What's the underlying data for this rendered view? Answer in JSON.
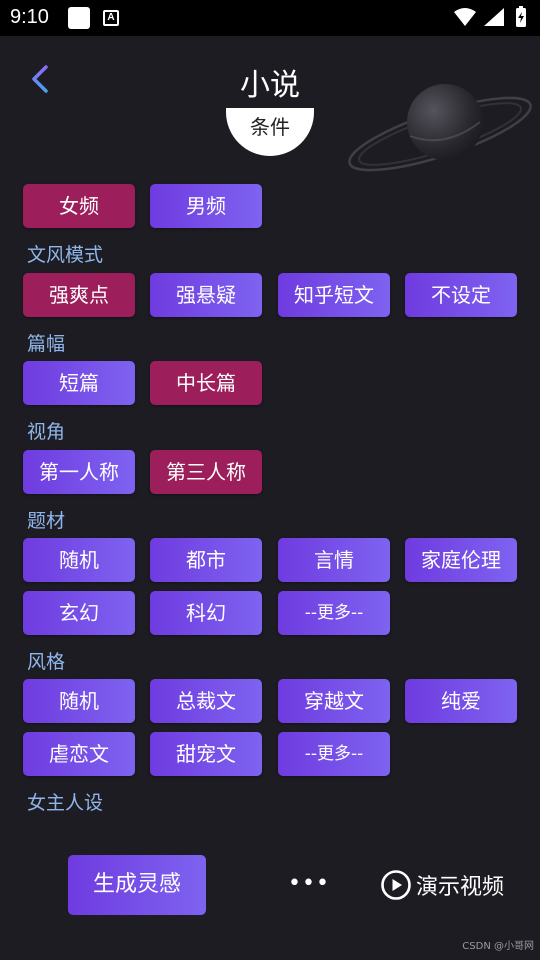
{
  "status": {
    "time": "9:10",
    "a_icon": "A"
  },
  "header": {
    "title": "小说",
    "badge": "条件"
  },
  "gender": {
    "options": [
      "女频",
      "男频"
    ]
  },
  "sections": [
    {
      "label": "文风模式",
      "options": [
        "强爽点",
        "强悬疑",
        "知乎短文",
        "不设定"
      ]
    },
    {
      "label": "篇幅",
      "options": [
        "短篇",
        "中长篇"
      ]
    },
    {
      "label": "视角",
      "options": [
        "第一人称",
        "第三人称"
      ]
    },
    {
      "label": "题材",
      "options": [
        "随机",
        "都市",
        "言情",
        "家庭伦理",
        "玄幻",
        "科幻",
        "--更多--"
      ]
    },
    {
      "label": "风格",
      "options": [
        "随机",
        "总裁文",
        "穿越文",
        "纯爱",
        "虐恋文",
        "甜宠文",
        "--更多--"
      ]
    },
    {
      "label": "女主人设"
    }
  ],
  "footer": {
    "generate": "生成灵感",
    "more": "•••",
    "demo": "演示视频"
  },
  "watermark": "CSDN @小哥网",
  "colors": {
    "selected": "#9c1f5c",
    "chip_start": "#6f3be0",
    "chip_end": "#7e63f0",
    "label": "#8fb6ea",
    "background": "#1d1c23"
  },
  "icons": [
    "back-arrow-icon",
    "planet-icon",
    "play-circle-icon",
    "wifi-icon",
    "signal-icon",
    "battery-icon"
  ]
}
